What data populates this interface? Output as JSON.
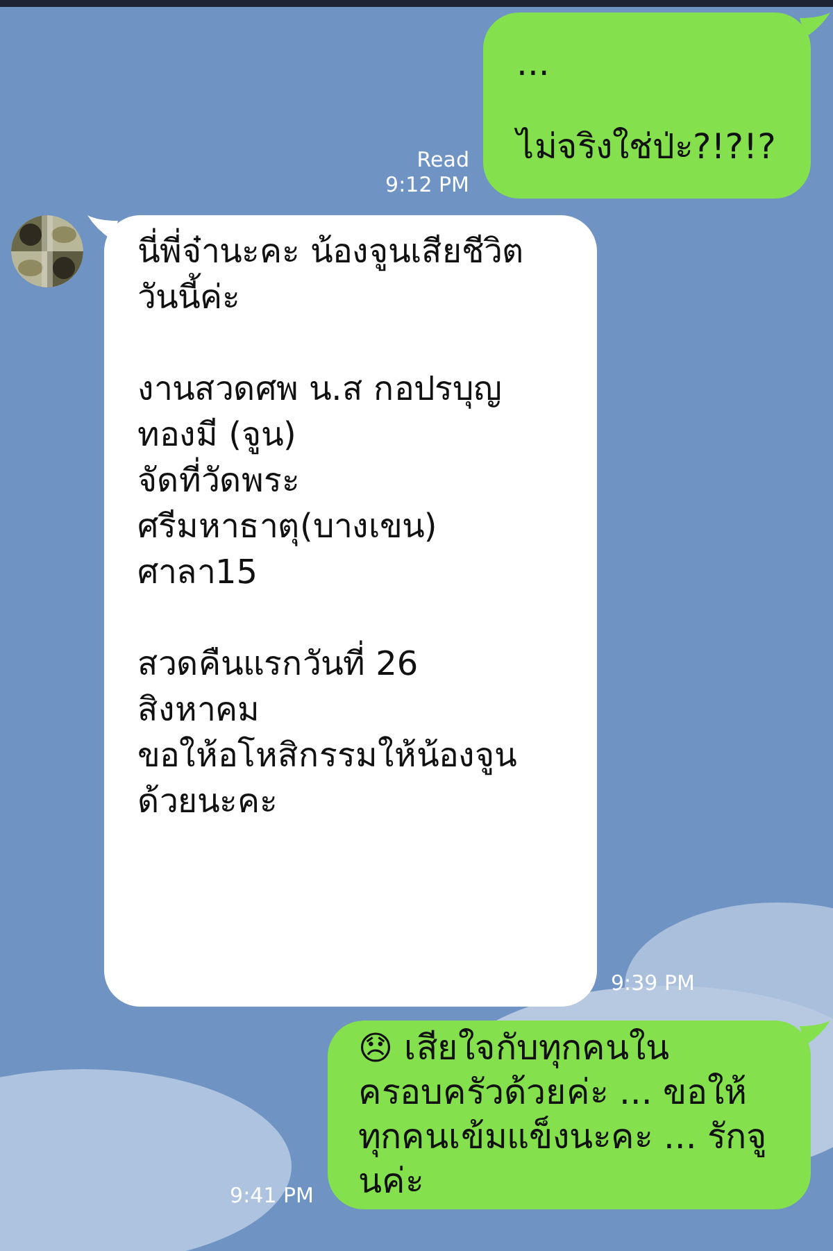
{
  "messages": [
    {
      "kind": "sent",
      "text": "...\n\nไม่จริงใช่ป่ะ?!?!?",
      "read": "Read",
      "time": "9:12 PM"
    },
    {
      "kind": "received",
      "text": "นี่พี่จ๋านะคะ น้องจูนเสียชีวิต\nวันนี้ค่ะ\n\nงานสวดศพ น.ส กอปรบุญ\nทองมี (จูน)\nจัดที่วัดพระ\nศรีมหาธาตุ(บางเขน)\nศาลา15\n\nสวดคืนแรกวันที่ 26\nสิงหาคม\nขอให้อโหสิกรรมให้น้องจูน\nด้วยนะคะ",
      "time": "9:39 PM"
    },
    {
      "kind": "sent",
      "emoji": "😞",
      "text": "เสียใจกับทุกคนใน\nครอบครัวด้วยค่ะ ... ขอให้\nทุกคนเข้มแข็งนะคะ ... รักจู\nนค่ะ",
      "time": "9:41 PM"
    }
  ]
}
